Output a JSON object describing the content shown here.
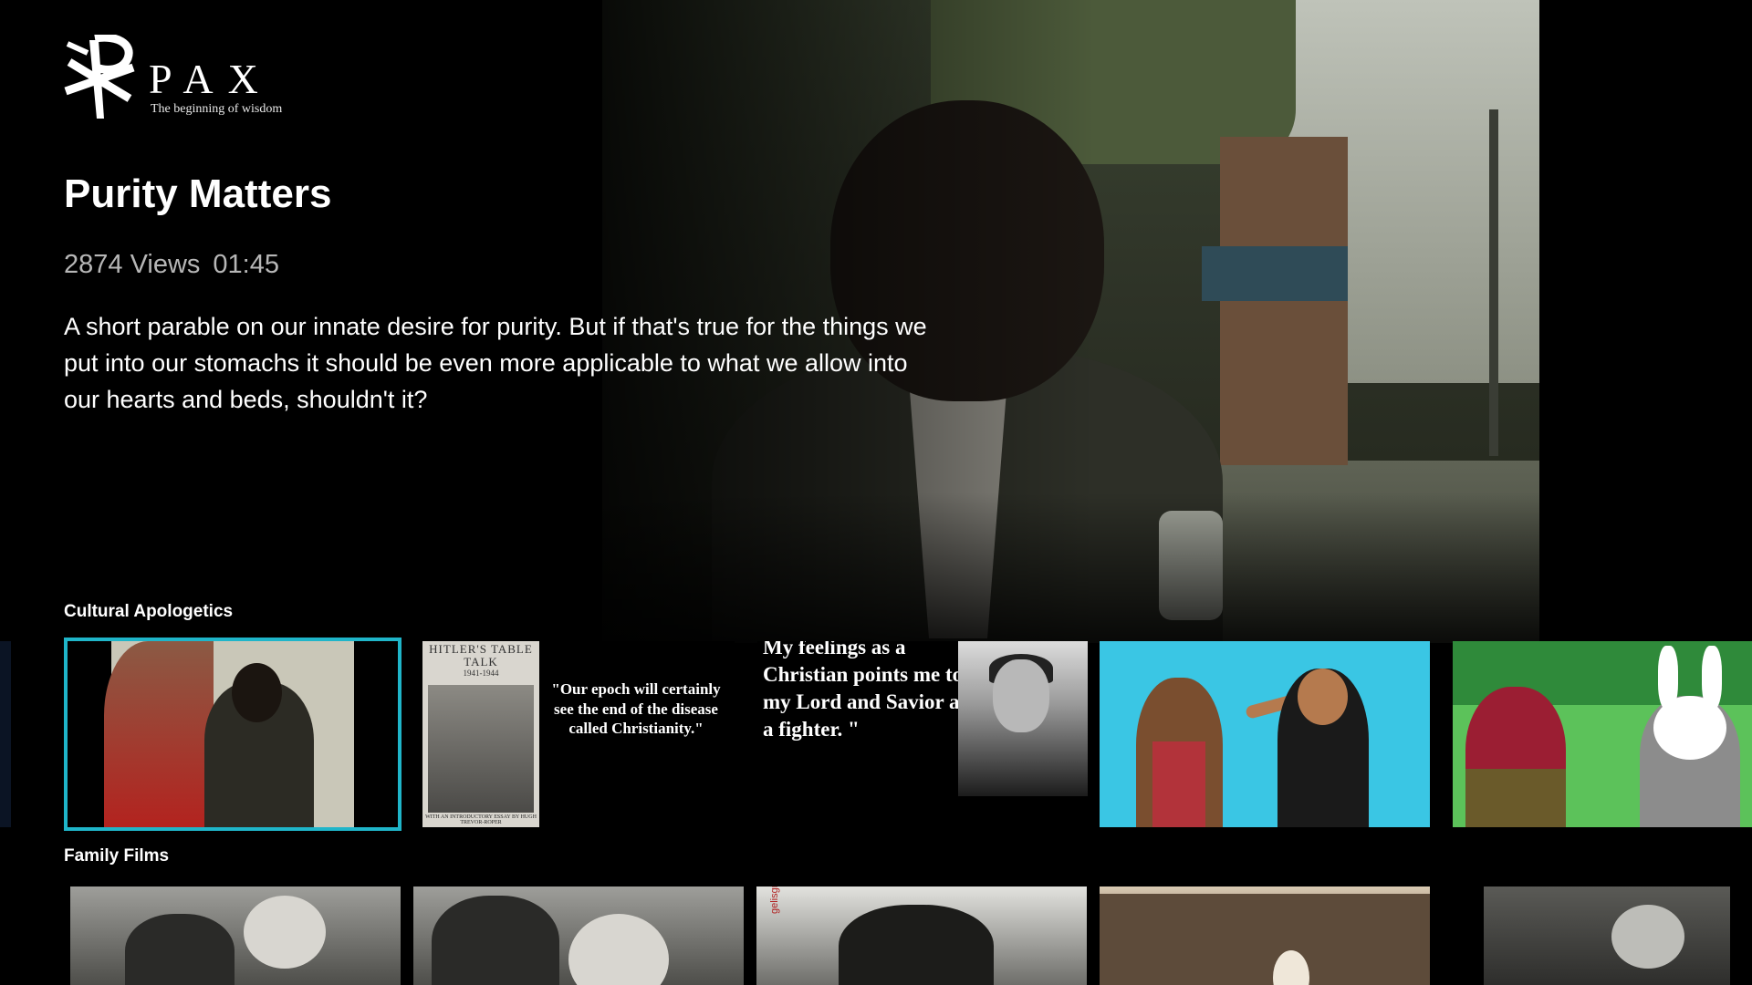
{
  "brand": {
    "name": "PAX",
    "tagline": "The beginning of wisdom"
  },
  "hero": {
    "title": "Purity Matters",
    "views": "2874 Views",
    "duration": "01:45",
    "description": "A short parable on our innate desire for purity. But if that's true for the things we put into our stomachs it should be even more applicable to what we allow into our hearts and beds, shouldn't it?"
  },
  "rows": [
    {
      "title": "Cultural Apologetics",
      "tiles": [
        {
          "kind": "video-still",
          "focused": true
        },
        {
          "kind": "book-quote",
          "book_title": "HITLER'S TABLE TALK",
          "book_years": "1941-1944",
          "book_caption": "WITH AN INTRODUCTORY ESSAY BY HUGH TREVOR-ROPER",
          "quote": "\"Our epoch will certainly see the end of the disease called Christianity.\""
        },
        {
          "kind": "portrait-quote",
          "quote": "My feelings as a Christian points me to my Lord and Savior as a fighter. \""
        },
        {
          "kind": "cartoon"
        },
        {
          "kind": "cartoon-rabbit"
        }
      ]
    },
    {
      "title": "Family Films",
      "tiles": [
        {
          "kind": "film-still"
        },
        {
          "kind": "film-still"
        },
        {
          "kind": "film-still",
          "vertical_text": "gelisgroup.com"
        },
        {
          "kind": "sepia-still"
        },
        {
          "kind": "film-still"
        }
      ]
    }
  ],
  "colors": {
    "focus": "#1fb5c9",
    "background": "#000000",
    "meta_text": "#b7b7b7"
  }
}
